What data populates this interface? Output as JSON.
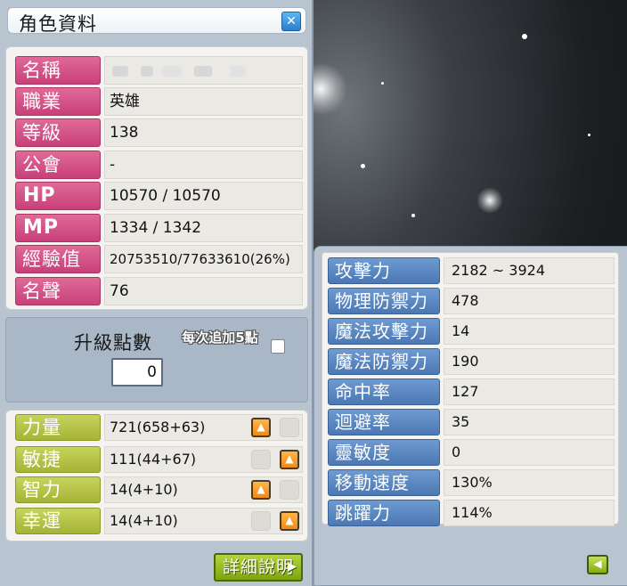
{
  "character_window": {
    "title": "角色資料",
    "close_icon": "close-icon",
    "info_rows": [
      {
        "label": "名稱",
        "value": ""
      },
      {
        "label": "職業",
        "value": "英雄"
      },
      {
        "label": "等級",
        "value": "138"
      },
      {
        "label": "公會",
        "value": "-"
      },
      {
        "label": "HP",
        "value": "10570 / 10570"
      },
      {
        "label": "MP",
        "value": "1334 / 1342"
      },
      {
        "label": "經驗值",
        "value": "20753510/77633610(26%)"
      },
      {
        "label": "名聲",
        "value": "76"
      }
    ],
    "ability_points": {
      "label": "升級點數",
      "value": "0",
      "auto_add_label": "每次追加5點",
      "auto_add_checked": false
    },
    "stats": [
      {
        "label": "力量",
        "value": "721(658+63)"
      },
      {
        "label": "敏捷",
        "value": "111(44+67)"
      },
      {
        "label": "智力",
        "value": "14(4+10)"
      },
      {
        "label": "幸運",
        "value": "14(4+10)"
      }
    ],
    "detail_button": "詳細說明"
  },
  "detail_window": {
    "rows": [
      {
        "label": "攻擊力",
        "value": "2182 ~ 3924"
      },
      {
        "label": "物理防禦力",
        "value": "478"
      },
      {
        "label": "魔法攻擊力",
        "value": "14"
      },
      {
        "label": "魔法防禦力",
        "value": "190"
      },
      {
        "label": "命中率",
        "value": "127"
      },
      {
        "label": "迴避率",
        "value": "35"
      },
      {
        "label": "靈敏度",
        "value": "0"
      },
      {
        "label": "移動速度",
        "value": "130%"
      },
      {
        "label": "跳躍力",
        "value": "114%"
      }
    ],
    "back_icon": "arrow-left-icon"
  },
  "colors": {
    "pink_label": "#d04f85",
    "green_label": "#b3c241",
    "blue_label": "#5a86c2",
    "orange_button": "#f39a22",
    "window_bg": "#b9c4d1"
  }
}
